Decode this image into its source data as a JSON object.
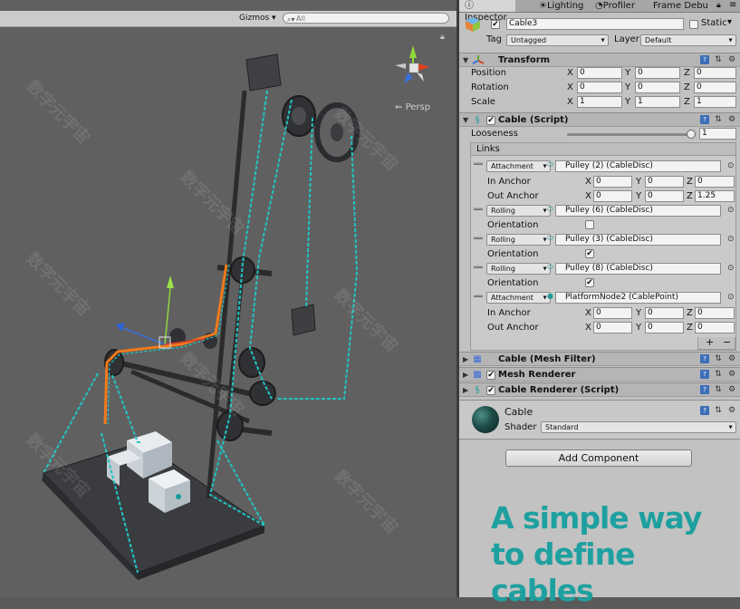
{
  "scene": {
    "gizmos_label": "Gizmos",
    "search_placeholder": "All",
    "persp_label": "Persp"
  },
  "tabs": [
    {
      "label": "Inspector",
      "icon": "info-icon"
    },
    {
      "label": "Lighting",
      "icon": "bulb-icon"
    },
    {
      "label": "Profiler",
      "icon": "profiler-icon"
    },
    {
      "label": "Frame Debu",
      "icon": ""
    }
  ],
  "object": {
    "name": "Cable3",
    "static_label": "Static",
    "tag_label": "Tag",
    "tag_value": "Untagged",
    "layer_label": "Layer",
    "layer_value": "Default"
  },
  "transform": {
    "title": "Transform",
    "rows": [
      {
        "label": "Position",
        "x": "0",
        "y": "0",
        "z": "0"
      },
      {
        "label": "Rotation",
        "x": "0",
        "y": "0",
        "z": "0"
      },
      {
        "label": "Scale",
        "x": "1",
        "y": "1",
        "z": "1"
      }
    ],
    "axis_x": "X",
    "axis_y": "Y",
    "axis_z": "Z"
  },
  "cable_script": {
    "title": "Cable (Script)",
    "looseness_label": "Looseness",
    "looseness_value": "1",
    "looseness_fraction": 0.95,
    "links_label": "Links",
    "links": [
      {
        "type": "Attachment",
        "target": "Pulley (2) (CableDisc)"
      },
      {
        "type": "Rolling",
        "target": "Pulley (6) (CableDisc)"
      },
      {
        "type": "Rolling",
        "target": "Pulley (3) (CableDisc)"
      },
      {
        "type": "Rolling",
        "target": "Pulley (8) (CableDisc)"
      },
      {
        "type": "Attachment",
        "target": "PlatformNode2 (CablePoint)"
      }
    ],
    "in_anchor_label": "In Anchor",
    "out_anchor_label": "Out Anchor",
    "orientation_label": "Orientation",
    "anchor1_in": {
      "x": "0",
      "y": "0",
      "z": "0"
    },
    "anchor1_out": {
      "x": "0",
      "y": "0",
      "z": "1.25"
    },
    "anchor5_in": {
      "x": "0",
      "y": "0",
      "z": "0"
    },
    "anchor5_out": {
      "x": "0",
      "y": "0",
      "z": "0"
    },
    "add_label": "+",
    "remove_label": "−"
  },
  "mesh_filter": {
    "title": "Cable (Mesh Filter)"
  },
  "mesh_renderer": {
    "title": "Mesh Renderer"
  },
  "cable_renderer": {
    "title": "Cable Renderer (Script)"
  },
  "material": {
    "name": "Cable",
    "shader_label": "Shader",
    "shader_value": "Standard"
  },
  "add_component_label": "Add Component",
  "overlay_text": {
    "line1": "A simple way",
    "line2": "to define cables"
  },
  "colors": {
    "cable_cyan": "#22c4c4",
    "selection_orange": "#f07a1c",
    "overlay_teal": "#1fa0a0",
    "inspector_bg": "#c2c2c2"
  }
}
